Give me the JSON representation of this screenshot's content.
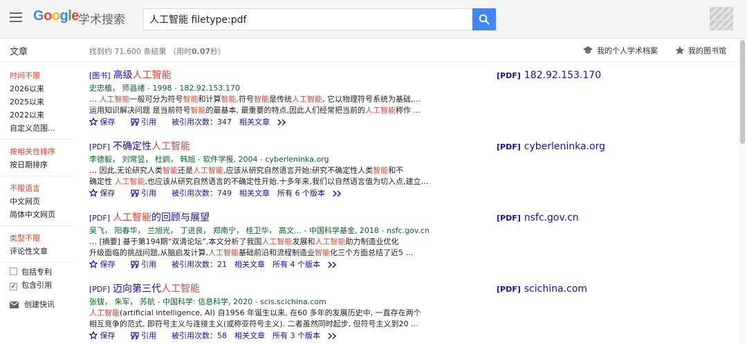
{
  "header": {
    "logo_letters": [
      "G",
      "o",
      "o",
      "g",
      "l",
      "e"
    ],
    "logo_sub": "学术搜索",
    "query": "人工智能 filetype:pdf"
  },
  "subheader": {
    "section": "文章",
    "stats_prefix": "找到约 71,600 条结果 （用时",
    "stats_time": "0.07",
    "stats_suffix": "秒）",
    "profile": "我的个人学术档案",
    "library": "我的图书馆"
  },
  "sidebar": {
    "time": [
      "时间不限",
      "2026以来",
      "2025以来",
      "2022以来",
      "自定义范围..."
    ],
    "sort": [
      "按相关性排序",
      "按日期排序"
    ],
    "lang": [
      "不限语言",
      "中文网页",
      "简体中文网页"
    ],
    "type": [
      "类型不限",
      "评论性文章"
    ],
    "checks": [
      {
        "label": "包括专利",
        "checked": false
      },
      {
        "label": "包含引用",
        "checked": true
      }
    ],
    "alert": "创建快讯"
  },
  "actions": {
    "save": "保存",
    "cite": "引用",
    "related": "相关文章"
  },
  "results": [
    {
      "tag": "[图书]",
      "title_pre": "高级",
      "title_hl": "人工智能",
      "title_post": "",
      "authors": "史忠植， 师昌绪 - 1998 - 182.92.153.170",
      "snippet1_parts": [
        "… ",
        "人工智能",
        "一般可分为符号",
        "智能",
        "和计算",
        "智能",
        ".符号",
        "智能",
        "是传统",
        "人工智能",
        ", 它以物理符号系统为基础,…"
      ],
      "snippet2_parts": [
        "运用知识解决问题 是当前符号",
        "智能",
        "的最基本, 最重要的特点,因此人们经常把当前的",
        "人工智能",
        "称作 …"
      ],
      "cited": "被引用次数：347",
      "versions": "",
      "pdf_tag": "[PDF]",
      "pdf_domain": "182.92.153.170"
    },
    {
      "tag": "[PDF]",
      "title_pre": "不确定性",
      "title_hl": "人工智能",
      "title_post": "",
      "authors": "李德毅， 刘常昱， 杜鹢， 韩旭 - 软件学报, 2004 - cyberleninka.org",
      "snippet1_parts": [
        "… 因此,无论研究人类",
        "智能",
        "还是",
        "人工智能",
        ",应该从研究自然语言开始;研究不确定性人类",
        "智能",
        "和不"
      ],
      "snippet2_parts": [
        "确定性 ",
        "人工智能",
        ",也应该从研究自然语言的不确定性开始.十多年来,我们以自然语言值为切入点,建立…"
      ],
      "cited": "被引用次数：749",
      "versions": "所有 6 个版本",
      "pdf_tag": "[PDF]",
      "pdf_domain": "cyberleninka.org"
    },
    {
      "tag": "[PDF]",
      "title_pre": "",
      "title_hl": "人工智能",
      "title_post": "的回顾与展望",
      "authors": "吴飞， 阳春华， 兰旭光， 丁进良， 郑南宁， 桂卫华， 高文… - 中国科学基金, 2018 - nsfc.gov.cn",
      "snippet1_parts": [
        "… [摘要] 基于第194期“双清论坛”,本文分析了我国",
        "人工智能",
        "发展和",
        "人工智能",
        "助力制造业优化"
      ],
      "snippet2_parts": [
        "升级面临的挑战问题,从脑启发计算,",
        "人工智能",
        "基础前沿和流程制造业",
        "智能",
        "化三个方面总结了近5 …"
      ],
      "cited": "被引用次数：21",
      "versions": "所有 4 个版本",
      "pdf_tag": "[PDF]",
      "pdf_domain": "nsfc.gov.cn"
    },
    {
      "tag": "[PDF]",
      "title_pre": "迈向第三代",
      "title_hl": "人工智能",
      "title_post": "",
      "authors": "张钹， 朱军， 苏航 - 中国科学: 信息科学, 2020 - scis.scichina.com",
      "snippet1_parts": [
        "",
        "人工智能",
        "(artificial intelligence, AI) 自1956 年诞生以来, 在60 多年的发展历史中, 一直存在两个"
      ],
      "snippet2_parts": [
        "相互竞争的范式, 即符号主义与连接主义(或称亚符号主义). 二者虽然同时起步, 但符号主义到20 …"
      ],
      "cited": "被引用次数：58",
      "versions": "所有 3 个版本",
      "pdf_tag": "[PDF]",
      "pdf_domain": "scichina.com"
    }
  ]
}
